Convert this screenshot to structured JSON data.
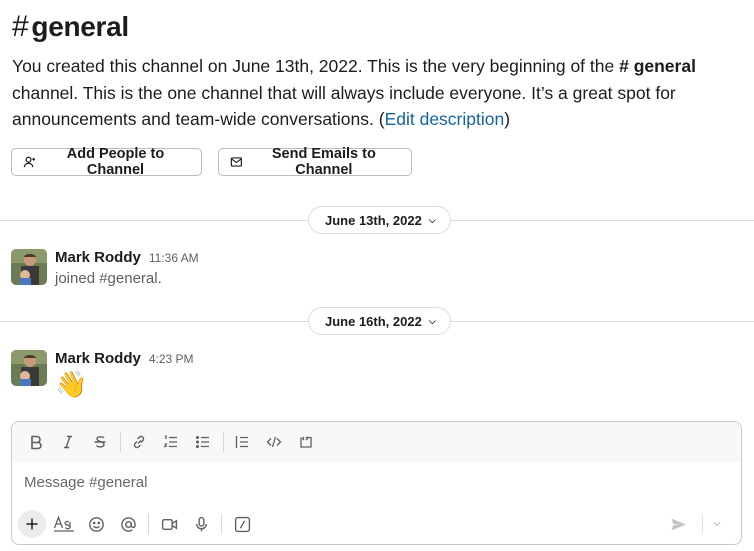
{
  "channel": {
    "hash": "#",
    "name": "general"
  },
  "intro": {
    "text_before": "You created this channel on June 13th, 2022. This is the very beginning of the ",
    "channel_ref": "# general",
    "text_after": " channel. This is the one channel that will always include everyone. It’s a great spot for announcements and team-wide conversations. (",
    "edit_link": "Edit description",
    "close_paren": ")"
  },
  "actions": {
    "add_people": "Add People to Channel",
    "send_emails": "Send Emails to Channel"
  },
  "dates": [
    {
      "label": "June 13th, 2022"
    },
    {
      "label": "June 16th, 2022"
    }
  ],
  "messages": [
    {
      "author": "Mark Roddy",
      "time": "11:36 AM",
      "text": "joined #general."
    },
    {
      "author": "Mark Roddy",
      "time": "4:23 PM",
      "text": "👋"
    }
  ],
  "composer": {
    "placeholder": "Message #general",
    "value": ""
  },
  "icons": {
    "formatting": [
      "bold-icon",
      "italic-icon",
      "strikethrough-icon",
      "link-icon",
      "ordered-list-icon",
      "bulleted-list-icon",
      "blockquote-icon",
      "code-icon",
      "code-block-icon"
    ],
    "bottom": [
      "plus-icon",
      "text-format-icon",
      "emoji-icon",
      "mention-icon",
      "video-icon",
      "microphone-icon",
      "slash-command-icon",
      "send-icon",
      "chevron-down-icon"
    ]
  },
  "colors": {
    "link": "#1264a3",
    "text": "#1d1c1d",
    "muted": "#616061"
  }
}
